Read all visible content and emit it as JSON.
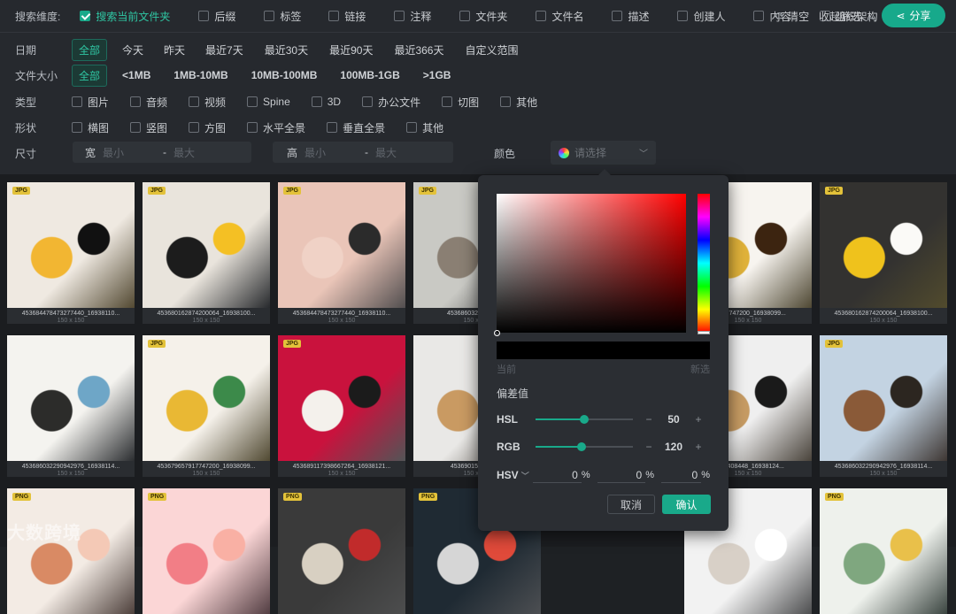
{
  "top": {
    "search_scope_label": "搜索维度:",
    "checks": [
      {
        "label": "搜索当前文件夹",
        "checked": true
      },
      {
        "label": "后缀",
        "checked": false
      },
      {
        "label": "标签",
        "checked": false
      },
      {
        "label": "链接",
        "checked": false
      },
      {
        "label": "注释",
        "checked": false
      },
      {
        "label": "文件夹",
        "checked": false
      },
      {
        "label": "文件名",
        "checked": false
      },
      {
        "label": "描述",
        "checked": false
      },
      {
        "label": "创建人",
        "checked": false
      },
      {
        "label": "内容",
        "checked": false
      },
      {
        "label": "组织架构",
        "checked": false
      }
    ],
    "clear_label": "清空",
    "collapse_label": "收起筛选",
    "share_label": "分享"
  },
  "filters": {
    "date": {
      "label": "日期",
      "options": [
        "全部",
        "今天",
        "昨天",
        "最近7天",
        "最近30天",
        "最近90天",
        "最近366天",
        "自定义范围"
      ]
    },
    "size": {
      "label": "文件大小",
      "options": [
        "全部",
        "<1MB",
        "1MB-10MB",
        "10MB-100MB",
        "100MB-1GB",
        ">1GB"
      ]
    },
    "type": {
      "label": "类型",
      "options": [
        "图片",
        "音频",
        "视频",
        "Spine",
        "3D",
        "办公文件",
        "切图",
        "其他"
      ]
    },
    "shape": {
      "label": "形状",
      "options": [
        "横图",
        "竖图",
        "方图",
        "水平全景",
        "垂直全景",
        "其他"
      ]
    },
    "dimension": {
      "label": "尺寸",
      "width_label": "宽",
      "height_label": "高",
      "min_placeholder": "最小",
      "max_placeholder": "最大",
      "dash": "-"
    },
    "color": {
      "label": "颜色",
      "placeholder": "请选择"
    }
  },
  "tiles": [
    {
      "name": "453684478473277440_16938110...",
      "dim": "150 x 150",
      "badge": "JPG",
      "colors": [
        "#efe9e1",
        "#f2b632",
        "#111111"
      ]
    },
    {
      "name": "453680162874200064_16938100...",
      "dim": "150 x 150",
      "badge": "JPG",
      "colors": [
        "#e9e4dc",
        "#1c1c1c",
        "#f4c024"
      ]
    },
    {
      "name": "453684478473277440_16938110...",
      "dim": "150 x 150",
      "badge": "JPG",
      "colors": [
        "#eac5b8",
        "#f0d2c6",
        "#2b2b2b"
      ]
    },
    {
      "name": "4536860322909429...",
      "dim": "150 x 150",
      "badge": "JPG",
      "colors": [
        "#c9c9c4",
        "#8a7f73",
        "#4a4640"
      ]
    },
    {
      "name": "...7917747200_16938099...",
      "dim": "150 x 150",
      "badge": "",
      "colors": [
        "#f7f4ef",
        "#e0b23a",
        "#3c2410"
      ]
    },
    {
      "name": "453680162874200064_16938100...",
      "dim": "150 x 150",
      "badge": "JPG",
      "colors": [
        "#333230",
        "#efc21c",
        "#fbfaf7"
      ]
    },
    {
      "name": "453686032290942976_16938114...",
      "dim": "150 x 150",
      "badge": "",
      "colors": [
        "#f4f3ef",
        "#2c2c2a",
        "#6ea6c7"
      ]
    },
    {
      "name": "453679657917747200_16938099...",
      "dim": "150 x 150",
      "badge": "JPG",
      "colors": [
        "#f5f1ea",
        "#e9b834",
        "#3c8a4a"
      ]
    },
    {
      "name": "453689117398667264_16938121...",
      "dim": "150 x 150",
      "badge": "JPG",
      "colors": [
        "#c9123d",
        "#f4f1ec",
        "#1b1b1b"
      ]
    },
    {
      "name": "45369015379448...",
      "dim": "150 x 150",
      "badge": "",
      "colors": [
        "#e9e8e6",
        "#c99a62",
        "#ffffff"
      ]
    },
    {
      "name": "...794408448_16938124...",
      "dim": "150 x 150",
      "badge": "",
      "colors": [
        "#efefef",
        "#c69b63",
        "#1a1a1a"
      ]
    },
    {
      "name": "453686032290942976_16938114...",
      "dim": "150 x 150",
      "badge": "JPG",
      "colors": [
        "#c3d3e2",
        "#8a5a38",
        "#2c2620"
      ]
    },
    {
      "name": "",
      "dim": "",
      "badge": "PNG",
      "colors": [
        "#f3ebe4",
        "#d98a64",
        "#f4c9b6"
      ]
    },
    {
      "name": "",
      "dim": "",
      "badge": "PNG",
      "colors": [
        "#fbd6d6",
        "#f27e86",
        "#f9b0a4"
      ]
    },
    {
      "name": "",
      "dim": "",
      "badge": "PNG",
      "colors": [
        "#3a3a3a",
        "#d8d0c2",
        "#c12b2b"
      ]
    },
    {
      "name": "",
      "dim": "",
      "badge": "PNG",
      "colors": [
        "#1f2a33",
        "#d6d6d6",
        "#e04a3a"
      ]
    },
    {
      "name": "",
      "dim": "",
      "badge": "",
      "colors": [
        "#f2f2f2",
        "#d8d0c7",
        "#ffffff"
      ]
    },
    {
      "name": "",
      "dim": "",
      "badge": "PNG",
      "colors": [
        "#eef1ec",
        "#7fa77f",
        "#e9c04a"
      ]
    }
  ],
  "picker": {
    "current_label": "当前",
    "new_label": "新选",
    "offset_label": "偏差值",
    "hsl": {
      "label": "HSL",
      "value": "50",
      "fraction": 0.5
    },
    "rgb": {
      "label": "RGB",
      "value": "120",
      "fraction": 0.47
    },
    "hsv": {
      "label": "HSV",
      "h": "0",
      "s": "0",
      "v": "0",
      "unit": "%"
    },
    "cancel_label": "取消",
    "confirm_label": "确认",
    "minus": "−",
    "plus": "+"
  },
  "watermark": "大数跨境",
  "accent": "#19a98a"
}
